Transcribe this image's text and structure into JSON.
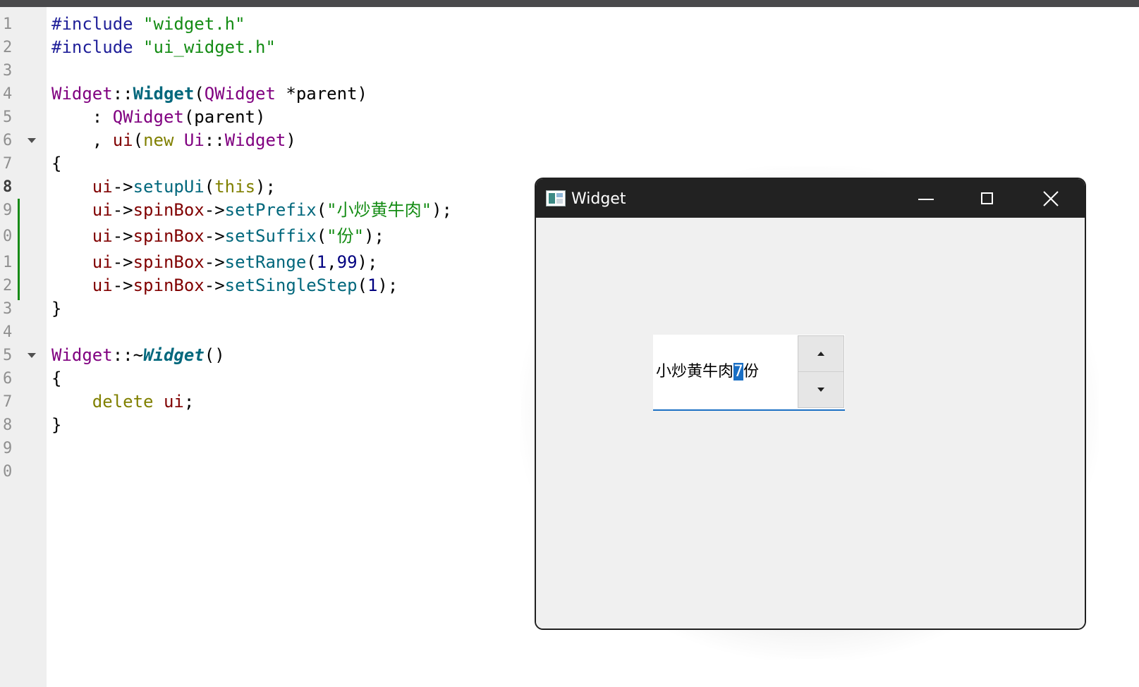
{
  "editor": {
    "line_numbers": [
      "1",
      "2",
      "3",
      "4",
      "5",
      "6",
      "7",
      "8",
      "9",
      "0",
      "1",
      "2",
      "3",
      "4",
      "5",
      "6",
      "7",
      "8",
      "9",
      "0"
    ],
    "current_line_index": 7,
    "lines": [
      [
        {
          "t": "#include ",
          "c": "#1f1f99"
        },
        {
          "t": "\"widget.h\"",
          "c": "#148c14"
        }
      ],
      [
        {
          "t": "#include ",
          "c": "#1f1f99"
        },
        {
          "t": "\"ui_widget.h\"",
          "c": "#148c14"
        }
      ],
      [],
      [
        {
          "t": "Widget",
          "c": "#800080"
        },
        {
          "t": "::",
          "c": "#000000"
        },
        {
          "t": "Widget",
          "c": "#00677c",
          "b": true
        },
        {
          "t": "(",
          "c": "#000000"
        },
        {
          "t": "QWidget",
          "c": "#800080"
        },
        {
          "t": " *parent)",
          "c": "#000000"
        }
      ],
      [
        {
          "t": "    : ",
          "c": "#000000"
        },
        {
          "t": "QWidget",
          "c": "#800080"
        },
        {
          "t": "(parent)",
          "c": "#000000"
        }
      ],
      [
        {
          "t": "    , ",
          "c": "#000000"
        },
        {
          "t": "ui",
          "c": "#800000"
        },
        {
          "t": "(",
          "c": "#000000"
        },
        {
          "t": "new",
          "c": "#808000"
        },
        {
          "t": " ",
          "c": "#000000"
        },
        {
          "t": "Ui",
          "c": "#800080"
        },
        {
          "t": "::",
          "c": "#000000"
        },
        {
          "t": "Widget",
          "c": "#800080"
        },
        {
          "t": ")",
          "c": "#000000"
        }
      ],
      [
        {
          "t": "{",
          "c": "#000000"
        }
      ],
      [
        {
          "t": "    ",
          "c": "#000000"
        },
        {
          "t": "ui",
          "c": "#800000"
        },
        {
          "t": "->",
          "c": "#000000"
        },
        {
          "t": "setupUi",
          "c": "#00677c"
        },
        {
          "t": "(",
          "c": "#000000"
        },
        {
          "t": "this",
          "c": "#808000"
        },
        {
          "t": ");",
          "c": "#000000"
        }
      ],
      [
        {
          "t": "    ",
          "c": "#000000"
        },
        {
          "t": "ui",
          "c": "#800000"
        },
        {
          "t": "->",
          "c": "#000000"
        },
        {
          "t": "spinBox",
          "c": "#800000"
        },
        {
          "t": "->",
          "c": "#000000"
        },
        {
          "t": "setPrefix",
          "c": "#00677c"
        },
        {
          "t": "(",
          "c": "#000000"
        },
        {
          "t": "\"小炒黄牛肉\"",
          "c": "#148c14"
        },
        {
          "t": ");",
          "c": "#000000"
        }
      ],
      [
        {
          "t": "    ",
          "c": "#000000"
        },
        {
          "t": "ui",
          "c": "#800000"
        },
        {
          "t": "->",
          "c": "#000000"
        },
        {
          "t": "spinBox",
          "c": "#800000"
        },
        {
          "t": "->",
          "c": "#000000"
        },
        {
          "t": "setSuffix",
          "c": "#00677c"
        },
        {
          "t": "(",
          "c": "#000000"
        },
        {
          "t": "\"份\"",
          "c": "#148c14"
        },
        {
          "t": ");",
          "c": "#000000"
        }
      ],
      [
        {
          "t": "    ",
          "c": "#000000"
        },
        {
          "t": "ui",
          "c": "#800000"
        },
        {
          "t": "->",
          "c": "#000000"
        },
        {
          "t": "spinBox",
          "c": "#800000"
        },
        {
          "t": "->",
          "c": "#000000"
        },
        {
          "t": "setRange",
          "c": "#00677c"
        },
        {
          "t": "(",
          "c": "#000000"
        },
        {
          "t": "1",
          "c": "#000080"
        },
        {
          "t": ",",
          "c": "#000000"
        },
        {
          "t": "99",
          "c": "#000080"
        },
        {
          "t": ");",
          "c": "#000000"
        }
      ],
      [
        {
          "t": "    ",
          "c": "#000000"
        },
        {
          "t": "ui",
          "c": "#800000"
        },
        {
          "t": "->",
          "c": "#000000"
        },
        {
          "t": "spinBox",
          "c": "#800000"
        },
        {
          "t": "->",
          "c": "#000000"
        },
        {
          "t": "setSingleStep",
          "c": "#00677c"
        },
        {
          "t": "(",
          "c": "#000000"
        },
        {
          "t": "1",
          "c": "#000080"
        },
        {
          "t": ");",
          "c": "#000000"
        }
      ],
      [
        {
          "t": "}",
          "c": "#000000"
        }
      ],
      [],
      [
        {
          "t": "Widget",
          "c": "#800080"
        },
        {
          "t": "::~",
          "c": "#000000"
        },
        {
          "t": "Widget",
          "c": "#00677c",
          "b": true,
          "i": true
        },
        {
          "t": "()",
          "c": "#000000"
        }
      ],
      [
        {
          "t": "{",
          "c": "#000000"
        }
      ],
      [
        {
          "t": "    ",
          "c": "#000000"
        },
        {
          "t": "delete",
          "c": "#808000"
        },
        {
          "t": " ",
          "c": "#000000"
        },
        {
          "t": "ui",
          "c": "#800000"
        },
        {
          "t": ";",
          "c": "#000000"
        }
      ],
      [
        {
          "t": "}",
          "c": "#000000"
        }
      ],
      [],
      []
    ],
    "fold_marker_lines": [
      5,
      14
    ],
    "modified_lines": [
      8,
      9,
      10,
      11
    ],
    "colors": {
      "modified_marker": "#168a16",
      "keyword": "#808000",
      "type": "#800080",
      "member": "#800000",
      "function": "#00677c",
      "string": "#148c14",
      "number": "#000080",
      "preprocessor": "#1f1f99"
    }
  },
  "window": {
    "title": "Widget",
    "icon": "app-window-icon",
    "controls": {
      "minimize": "minimize-icon",
      "maximize": "maximize-icon",
      "close": "close-icon"
    }
  },
  "spinbox": {
    "prefix": "小炒黄牛肉",
    "value": "7",
    "suffix": "份",
    "accent_color": "#1a6fc4",
    "up_icon": "spin-up-arrow-icon",
    "down_icon": "spin-down-arrow-icon"
  }
}
